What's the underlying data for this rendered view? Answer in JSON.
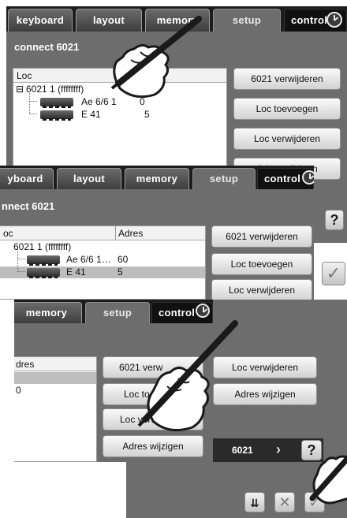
{
  "tabs": {
    "keyboard": "keyboard",
    "keyboard_cut": "yboard",
    "layout": "layout",
    "memory": "memory",
    "setup": "setup",
    "control": "control"
  },
  "connect": {
    "title": "connect 6021",
    "title_cut": "nnect 6021"
  },
  "list": {
    "col_loc": "Loc",
    "col_loc_cut": "oc",
    "col_adres": "Adres",
    "col_adres_cut": "dres",
    "group": "6021 1 (ffffffff)",
    "locs": [
      {
        "name": "Ae 6/6 1…",
        "address": "60"
      },
      {
        "name": "E 41",
        "address": "5"
      }
    ],
    "partial_address": "0",
    "cut_name": "Ae 6/6 1",
    "cut_addr": "0"
  },
  "buttons": {
    "remove_6021": "6021 verwijderen",
    "remove_6021_cut": "6021 verw",
    "add_loc": "Loc toevoegen",
    "add_loc_cut": "Loc toe",
    "remove_loc": "Loc verwijderen",
    "remove_loc_cut": "Loc verwijderen",
    "change_address": "Adres wijzigen"
  },
  "status": {
    "device": "6021",
    "help": "?",
    "arrow": "›"
  },
  "icons": {
    "ok": "check-icon",
    "cancel": "x-icon",
    "track": "track-icon",
    "stylus": "stylus-hand-icon"
  },
  "colors": {
    "panel": "#6d6d6d",
    "tabbar": "#1c1c1c",
    "control_tab": "#101010",
    "selection": "#bdbdbd"
  }
}
